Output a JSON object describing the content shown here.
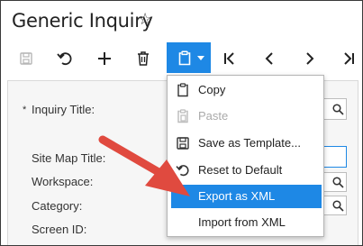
{
  "page": {
    "title": "Generic Inquiry"
  },
  "toolbar": {
    "items": [
      {
        "name": "save-icon",
        "state": "disabled"
      },
      {
        "name": "undo-icon",
        "state": "enabled"
      },
      {
        "name": "add-icon",
        "state": "enabled"
      },
      {
        "name": "delete-icon",
        "state": "enabled"
      },
      {
        "name": "clipboard-icon",
        "state": "active"
      },
      {
        "name": "first-record-icon",
        "state": "enabled"
      },
      {
        "name": "previous-record-icon",
        "state": "enabled"
      },
      {
        "name": "next-record-icon",
        "state": "enabled"
      },
      {
        "name": "last-record-icon",
        "state": "enabled"
      }
    ],
    "accent_color": "#1e88e5"
  },
  "form": {
    "required_marker": "*",
    "inquiry_title_label": "Inquiry Title:",
    "site_map_title_label": "Site Map Title:",
    "workspace_label": "Workspace:",
    "category_label": "Category:",
    "screen_id_label": "Screen ID:"
  },
  "menu": {
    "items": [
      {
        "label": "Copy",
        "icon": "copy-icon",
        "state": "enabled"
      },
      {
        "label": "Paste",
        "icon": "paste-icon",
        "state": "disabled"
      },
      {
        "label": "Save as Template...",
        "icon": "save-template-icon",
        "state": "enabled"
      },
      {
        "label": "Reset to Default",
        "icon": "reset-icon",
        "state": "enabled"
      },
      {
        "label": "Export as XML",
        "icon": "",
        "state": "highlighted"
      },
      {
        "label": "Import from XML",
        "icon": "",
        "state": "enabled"
      }
    ],
    "highlight_color": "#1e88e5"
  },
  "annotation": {
    "arrow_color": "#e04a3f"
  }
}
